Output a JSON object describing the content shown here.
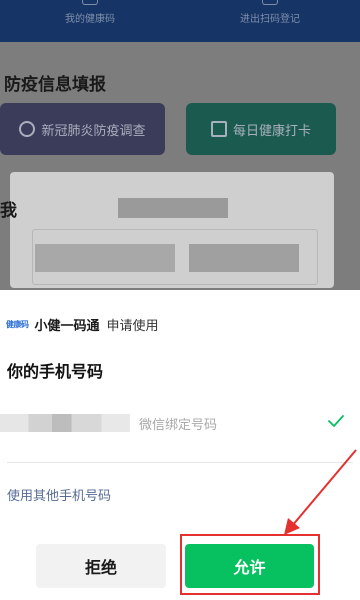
{
  "background": {
    "nav_left_label": "我的健康码",
    "nav_right_label": "进出扫码登记",
    "section_title": "防疫信息填报",
    "card_survey_label": "新冠肺炎防疫调查",
    "card_daily_label": "每日健康打卡",
    "cut_label": "我"
  },
  "sheet": {
    "app_logo_text": "健康码",
    "app_name": "小健一码通",
    "request_text": "申请使用",
    "title": "你的手机号码",
    "phone_option": {
      "masked_number": "",
      "hint": "微信绑定号码",
      "selected": true
    },
    "other_phone_link": "使用其他手机号码",
    "reject_label": "拒绝",
    "allow_label": "允许"
  },
  "colors": {
    "accent_green": "#07c160",
    "link_blue": "#576b95",
    "annotation_red": "#e53030"
  }
}
